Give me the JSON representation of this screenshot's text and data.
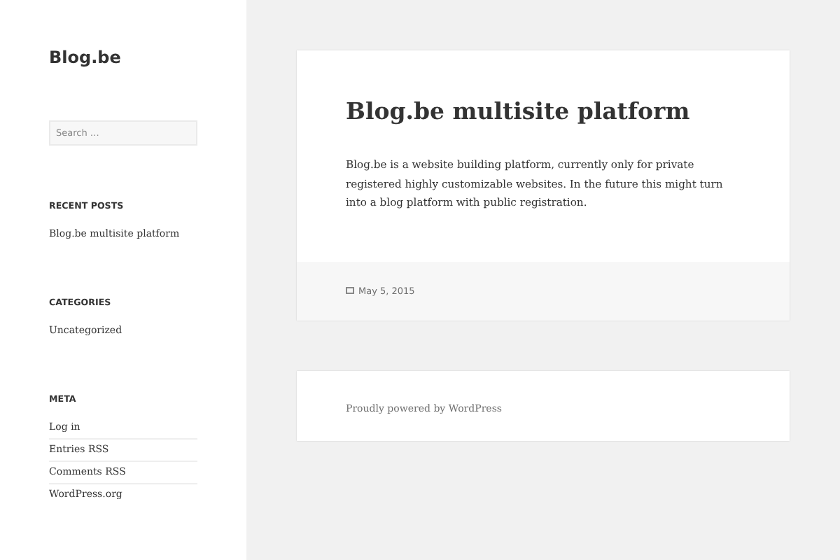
{
  "site_title": "Blog.be",
  "search": {
    "placeholder": "Search …"
  },
  "widgets": [
    {
      "title": "RECENT POSTS",
      "links": [
        "Blog.be multisite platform"
      ]
    },
    {
      "title": "CATEGORIES",
      "links": [
        "Uncategorized"
      ]
    },
    {
      "title": "META",
      "links": [
        "Log in",
        "Entries RSS",
        "Comments RSS",
        "WordPress.org"
      ]
    }
  ],
  "post": {
    "title": "Blog.be multisite platform",
    "body": "Blog.be is a website building platform, currently only for private registered highly customizable websites. In the future this might turn into a blog platform with public registration.",
    "date": "May 5, 2015"
  },
  "footer": "Proudly powered by WordPress"
}
